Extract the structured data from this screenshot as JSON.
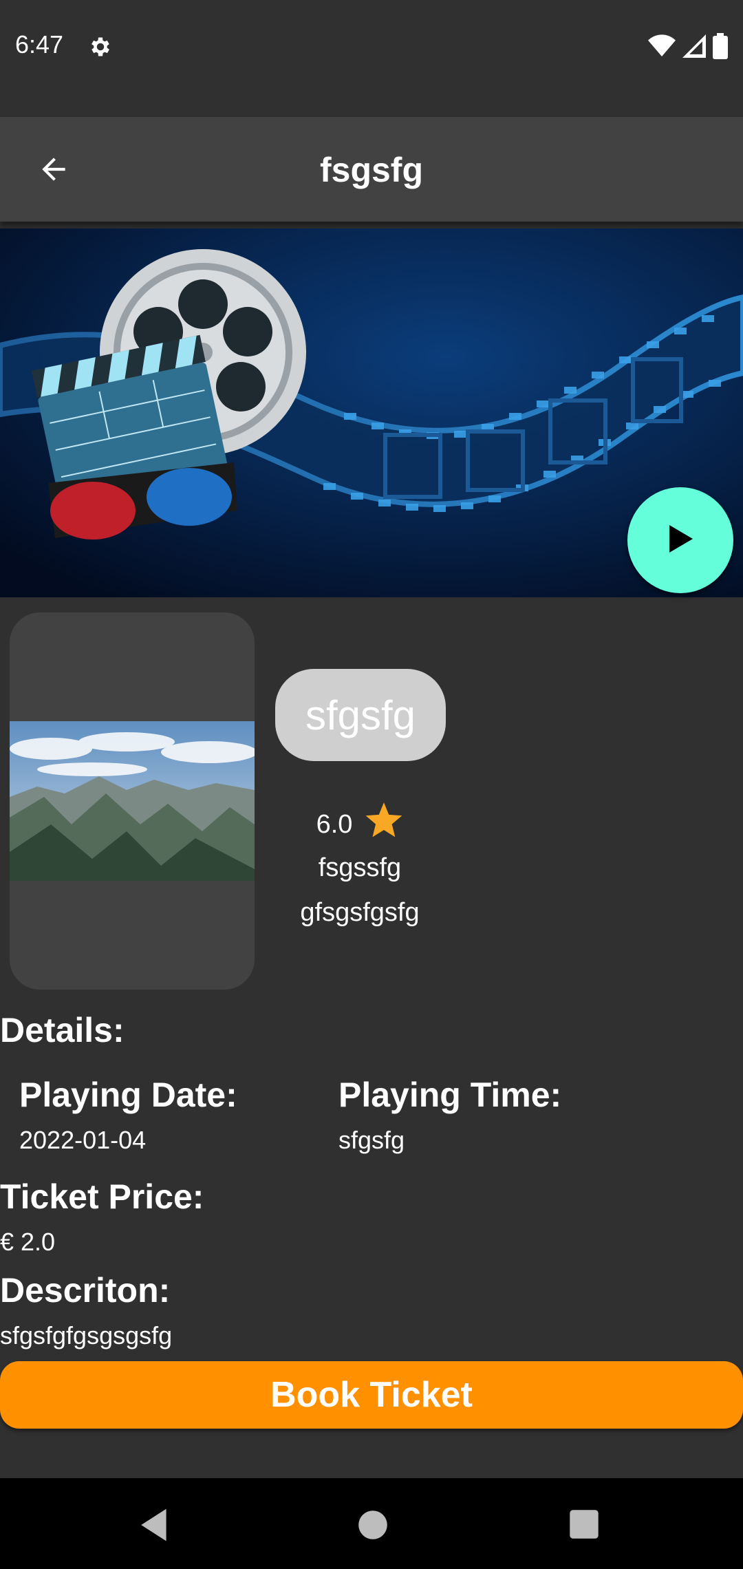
{
  "status_bar": {
    "time": "6:47",
    "icons": [
      "gear-icon",
      "wifi-icon",
      "signal-icon",
      "battery-icon"
    ]
  },
  "app_bar": {
    "title": "fsgsfg",
    "back_icon": "arrow-back-icon"
  },
  "movie": {
    "title": "sfgsfg",
    "rating": "6.0",
    "genre": "fsgssfg",
    "sub_genre": "gfsgsfgsfg"
  },
  "details": {
    "heading": "Details:",
    "playing_date_label": "Playing Date:",
    "playing_date": "2022-01-04",
    "playing_time_label": "Playing Time:",
    "playing_time": "sfgsfg",
    "ticket_price_label": "Ticket Price:",
    "ticket_price": "€ 2.0",
    "description_label": "Descriton:",
    "description": "sfgsfgfgsgsgsfg"
  },
  "actions": {
    "book_label": "Book Ticket"
  },
  "colors": {
    "background": "#303030",
    "app_bar": "#424242",
    "accent_fab": "#64ffda",
    "book_button": "#ff9100",
    "star": "#f9a825"
  }
}
